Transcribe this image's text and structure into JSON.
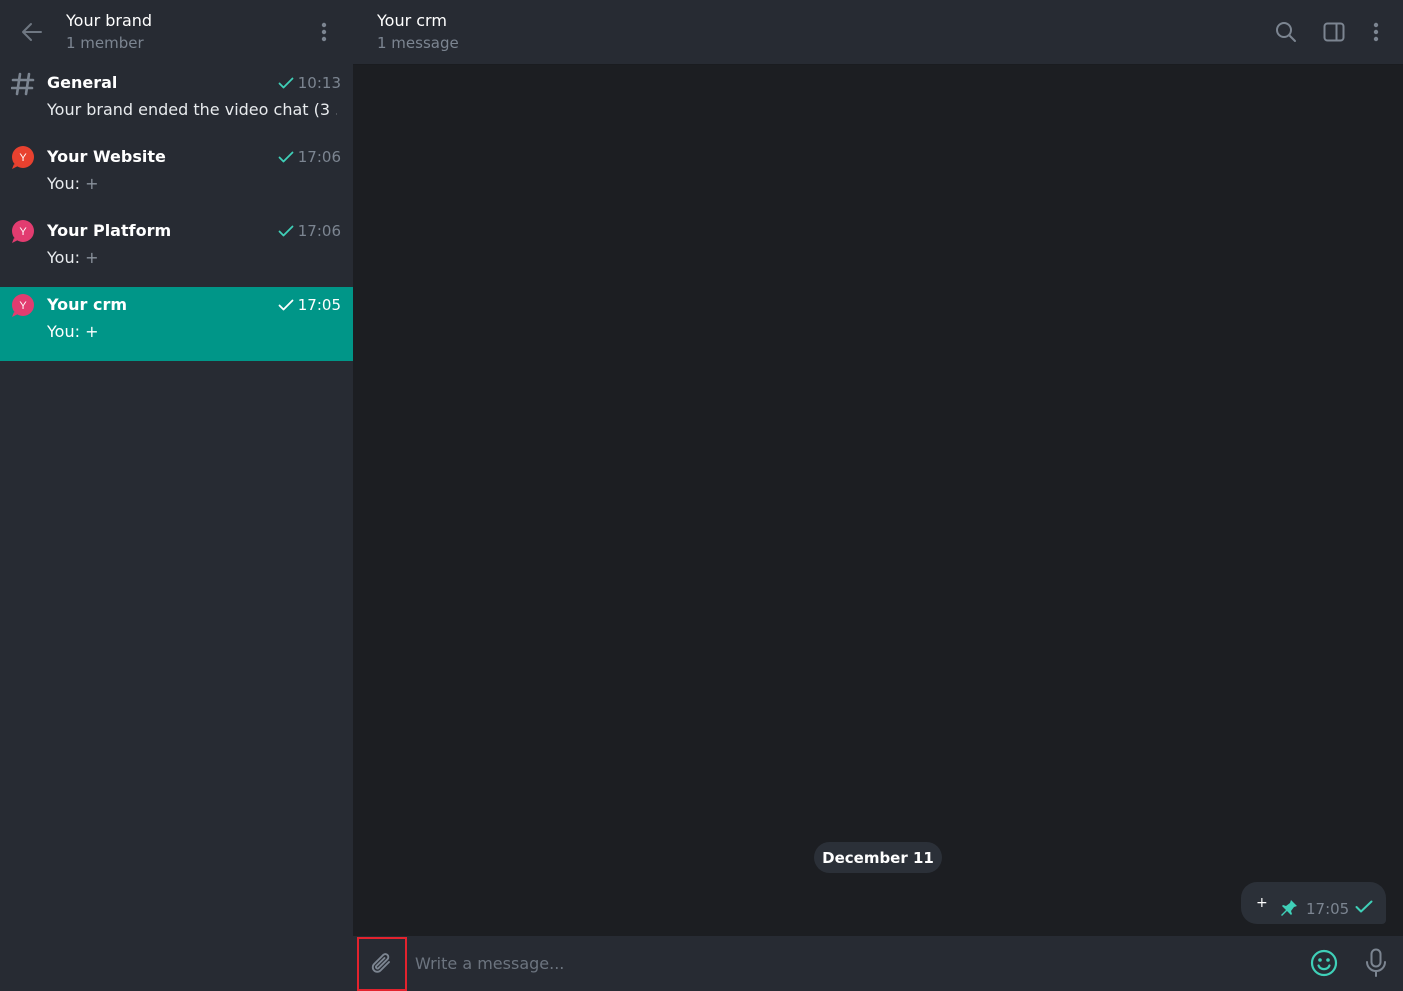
{
  "sidebar": {
    "title": "Your brand",
    "subtitle": "1 member",
    "chats": [
      {
        "name": "General",
        "time": "10:13",
        "preview": "Your brand ended the video chat (3 ...",
        "preview_sender": "",
        "avatar": "hash-icon",
        "active": false
      },
      {
        "name": "Your Website",
        "time": "17:06",
        "preview": "+",
        "preview_sender": "You: ",
        "avatar": "red-y-avatar",
        "avatar_color": "#e8412f",
        "avatar_letter": "Y",
        "active": false
      },
      {
        "name": "Your Platform",
        "time": "17:06",
        "preview": "+",
        "preview_sender": "You: ",
        "avatar": "pink-y-avatar",
        "avatar_color": "#e23c70",
        "avatar_letter": "Y",
        "active": false
      },
      {
        "name": "Your crm",
        "time": "17:05",
        "preview": "+",
        "preview_sender": "You: ",
        "avatar": "pink-y-avatar",
        "avatar_color": "#e23c70",
        "avatar_letter": "Y",
        "active": true
      }
    ]
  },
  "main": {
    "title": "Your crm",
    "subtitle": "1 message",
    "date_label": "December 11",
    "message": {
      "text": "+",
      "time": "17:05"
    },
    "composer": {
      "placeholder": "Write a message..."
    }
  },
  "colors": {
    "accent": "#009688",
    "check": "#3fd0b8",
    "highlight_border": "#e3232e"
  }
}
